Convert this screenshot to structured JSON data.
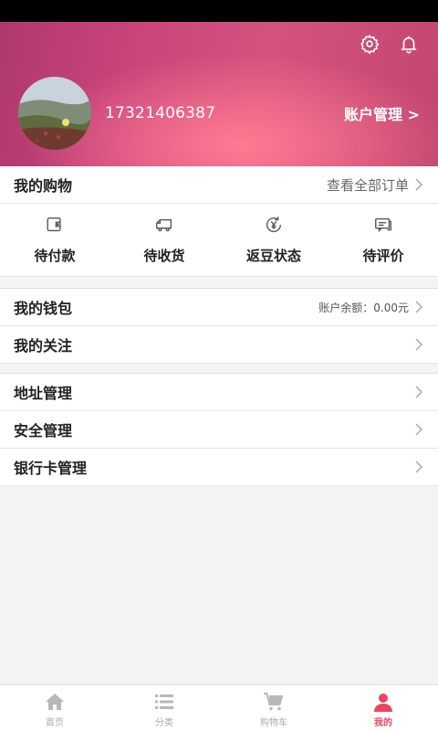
{
  "header": {
    "phone": "17321406387",
    "account_link": "账户管理 >"
  },
  "shopping": {
    "title": "我的购物",
    "view_all": "查看全部订单",
    "orders": [
      {
        "label": "待付款",
        "icon": "wallet-icon"
      },
      {
        "label": "待收货",
        "icon": "truck-icon"
      },
      {
        "label": "返豆状态",
        "icon": "yen-refresh-icon"
      },
      {
        "label": "待评价",
        "icon": "comment-icon"
      }
    ]
  },
  "wallet": {
    "title": "我的钱包",
    "balance": "账户余额：0.00元"
  },
  "follow": {
    "title": "我的关注"
  },
  "settings_list": [
    {
      "title": "地址管理"
    },
    {
      "title": "安全管理"
    },
    {
      "title": "银行卡管理"
    }
  ],
  "tabs": [
    {
      "label": "首页",
      "icon": "home-icon"
    },
    {
      "label": "分类",
      "icon": "list-icon"
    },
    {
      "label": "购物车",
      "icon": "cart-icon"
    },
    {
      "label": "我的",
      "icon": "user-icon"
    }
  ],
  "colors": {
    "header_accent": "#d4537e",
    "active_tab": "#e6475f"
  }
}
